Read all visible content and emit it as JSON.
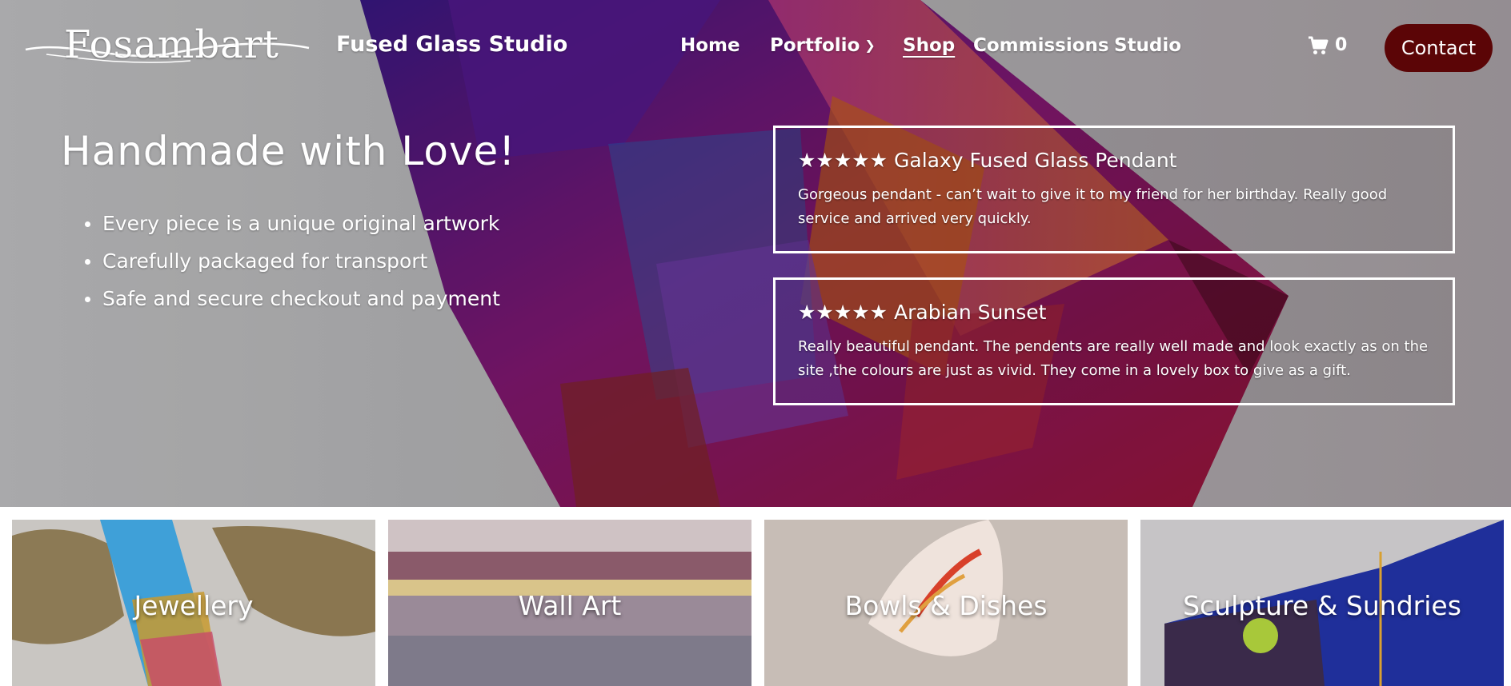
{
  "brand": {
    "logo_text": "Fosambart",
    "studio_name": "Fused Glass Studio"
  },
  "nav": {
    "items": [
      {
        "label": "Home"
      },
      {
        "label": "Portfolio"
      },
      {
        "label": "Shop"
      },
      {
        "label": "Commissions"
      },
      {
        "label": "Studio"
      }
    ],
    "active": "Shop",
    "cart_count": "0",
    "cart_icon": "shopping-cart-icon",
    "contact_label": "Contact"
  },
  "hero": {
    "title": "Handmade with Love!",
    "bullets": [
      "Every piece is a unique original artwork",
      "Carefully packaged for transport",
      "Safe and secure checkout and payment"
    ]
  },
  "reviews": [
    {
      "title": "★★★★★ Galaxy Fused Glass Pendant",
      "body": "Gorgeous pendant - can’t wait to give it to my friend for her birthday. Really good service and arrived very quickly."
    },
    {
      "title": "★★★★★ Arabian Sunset",
      "body": "Really beautiful pendant. The pendents are really well made and look exactly as on the site ,the colours are just as vivid. They come in a lovely box to give as a gift."
    }
  ],
  "categories": [
    {
      "label": "Jewellery"
    },
    {
      "label": "Wall Art"
    },
    {
      "label": "Bowls & Dishes"
    },
    {
      "label": "Sculpture & Sundries"
    }
  ],
  "colors": {
    "contact_button": "#5b0506",
    "text": "#ffffff"
  }
}
